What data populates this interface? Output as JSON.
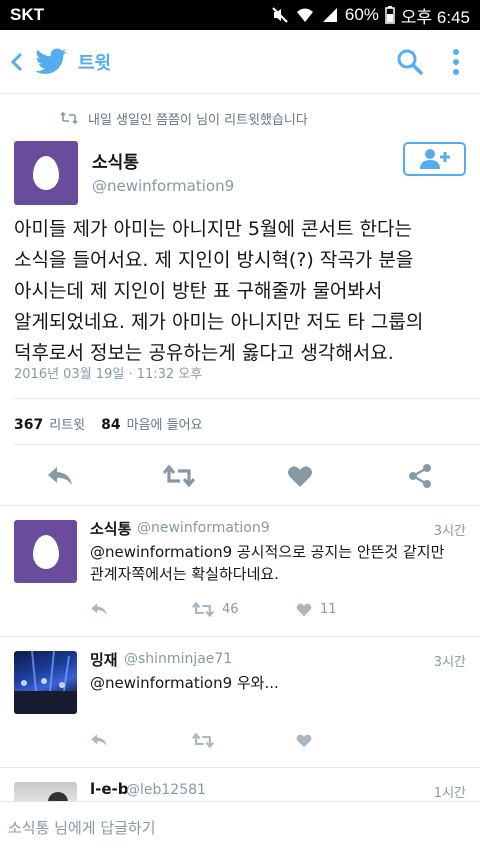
{
  "status_bar": {
    "carrier": "SKT",
    "battery": "60%",
    "time": "오후 6:45"
  },
  "app_bar": {
    "title": "트윗"
  },
  "retweet_context": "내일 생일인 쯤쯤이 님이 리트윗했습니다",
  "main_tweet": {
    "name": "소식통",
    "handle": "@newinformation9",
    "text": "아미들 제가 아미는 아니지만 5월에 콘서트 한다는\n소식을 들어서요. 제 지인이 방시혁(?) 작곡가 분을\n아시는데 제 지인이 방탄 표 구해줄까 물어봐서\n알게되었네요. 제가 아미는 아니지만 저도 타 그룹의\n덕후로서 정보는 공유하는게 옳다고 생각해서요.",
    "timestamp": "2016년 03월 19일 · 11:32 오후",
    "retweets_count": "367",
    "retweets_label": "리트윗",
    "likes_count": "84",
    "likes_label": "마음에 들어요"
  },
  "replies": [
    {
      "name": "소식통",
      "handle": "@newinformation9",
      "time": "3시간",
      "text": "@newinformation9 공시적으로 공지는 안뜬것 같지만\n관계자쪽에서는 확실하다네요.",
      "retweets": "46",
      "likes": "11"
    },
    {
      "name": "밍재",
      "handle": "@shinminjae71",
      "time": "3시간",
      "text": "@newinformation9 우와...",
      "retweets": "",
      "likes": ""
    },
    {
      "name": "l-e-b",
      "handle": "@leb12581",
      "time": "1시간"
    }
  ],
  "reply_bar": {
    "placeholder": "소식통 님에게 답글하기"
  },
  "colors": {
    "brand": "#55acee",
    "avatar_purple": "#6a4c9c",
    "muted": "#8899a6"
  }
}
